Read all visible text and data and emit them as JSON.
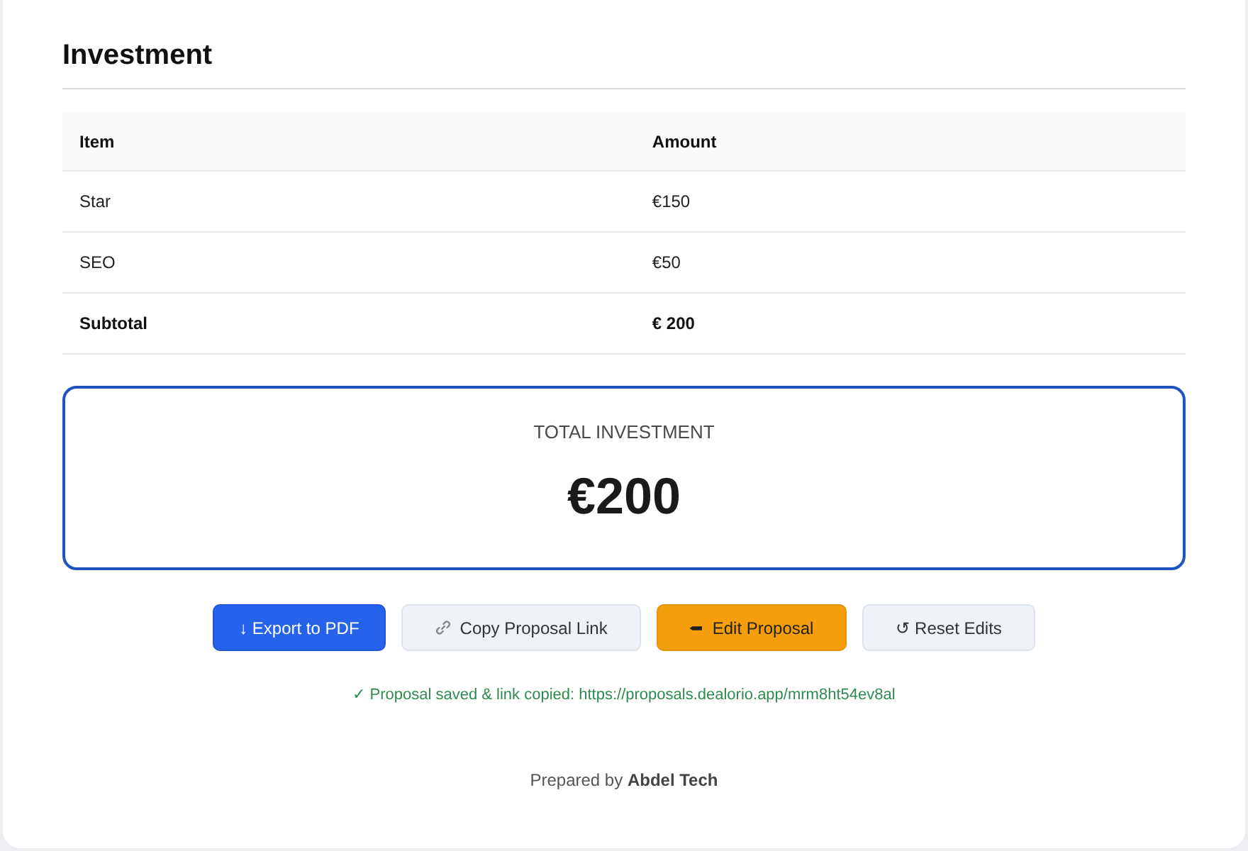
{
  "section": {
    "title": "Investment"
  },
  "table": {
    "columns": [
      "Item",
      "Amount"
    ],
    "rows": [
      {
        "kind": "item",
        "cells": [
          "Star",
          "€150"
        ]
      },
      {
        "kind": "item",
        "cells": [
          "SEO",
          "€50"
        ]
      },
      {
        "kind": "subtotal",
        "cells": [
          "Subtotal",
          "€ 200"
        ]
      }
    ]
  },
  "total": {
    "label": "TOTAL INVESTMENT",
    "amount": "€200"
  },
  "buttons": [
    {
      "kind": "export",
      "label": "↓ Export to PDF"
    },
    {
      "kind": "copy",
      "label": "Copy Proposal Link"
    },
    {
      "kind": "edit",
      "label": "Edit Proposal"
    },
    {
      "kind": "reset",
      "label": "↺ Reset Edits"
    }
  ],
  "status": {
    "message": "✓ Proposal saved & link copied: https://proposals.dealorio.app/mrm8ht54ev8al"
  },
  "footer": {
    "text": "Prepared by **Abdel Tech**"
  }
}
